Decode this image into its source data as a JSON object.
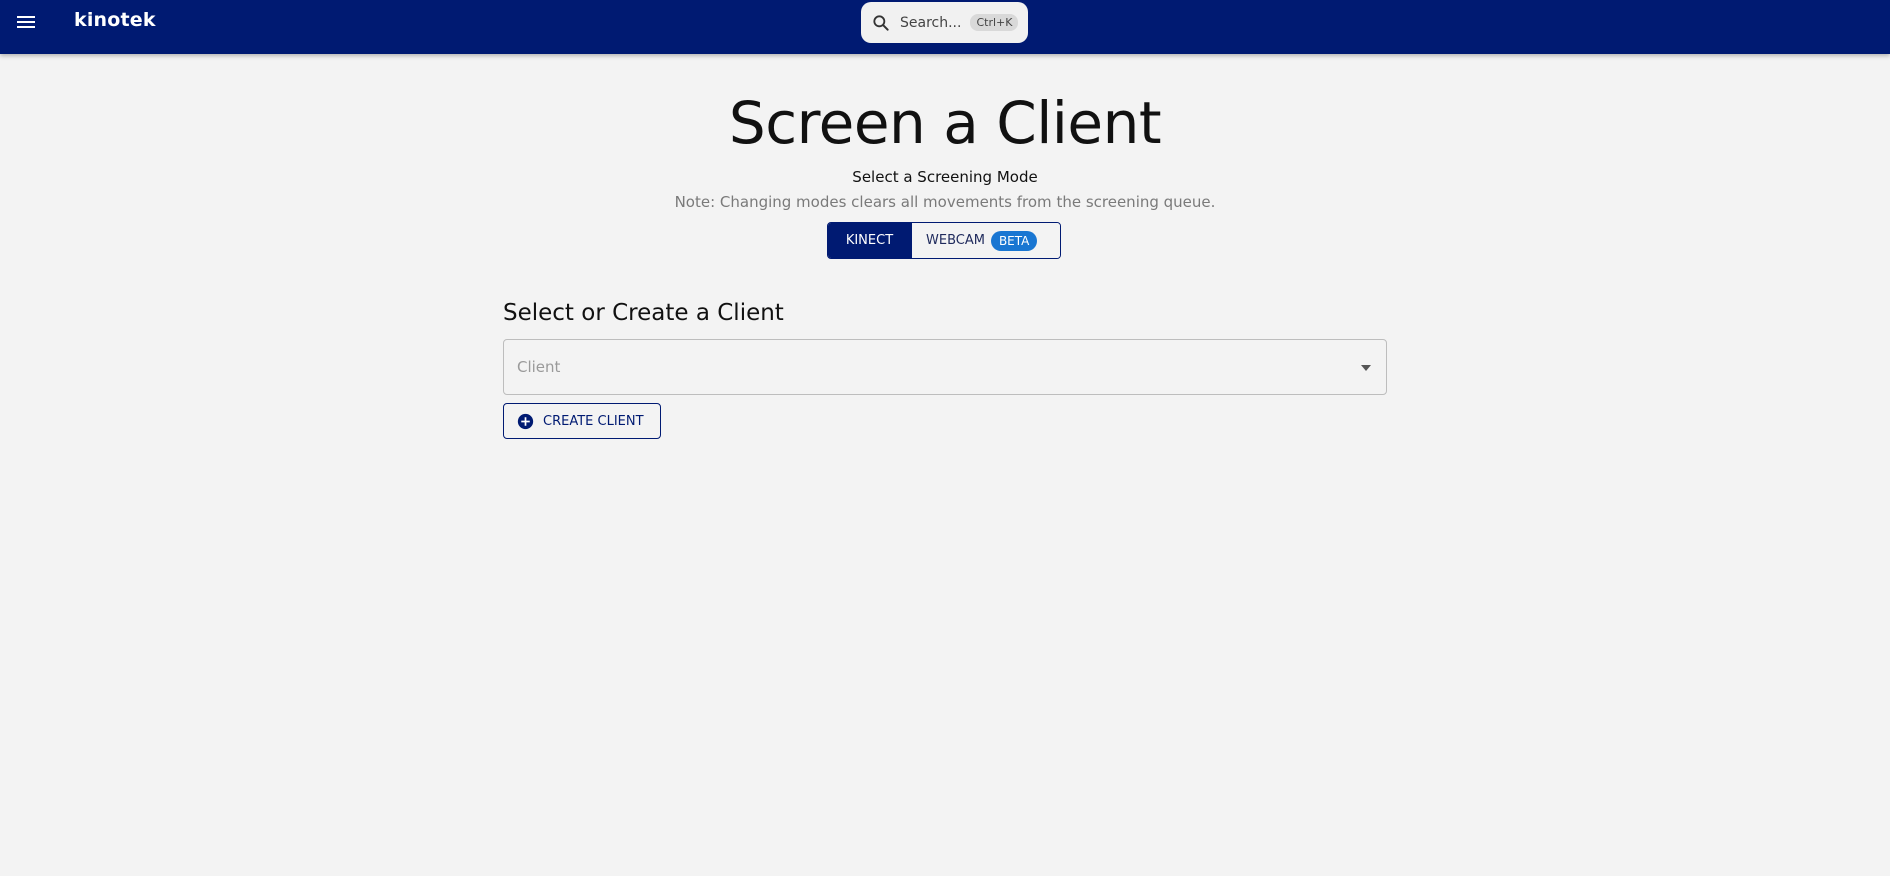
{
  "appbar": {
    "brand": "kinotek",
    "search": {
      "placeholder": "Search...",
      "shortcut": "Ctrl+K"
    },
    "menu_icon": "hamburger-menu-icon",
    "search_icon": "search-icon"
  },
  "page": {
    "title": "Screen a Client",
    "subtitle": "Select a Screening Mode",
    "note": "Note: Changing modes clears all movements from the screening queue."
  },
  "mode_toggle": {
    "selected": "KINECT",
    "options": [
      {
        "label": "KINECT",
        "active": true
      },
      {
        "label": "WEBCAM",
        "badge": "BETA",
        "active": false
      }
    ]
  },
  "client_section": {
    "title": "Select or Create a Client",
    "select": {
      "placeholder": "Client",
      "value": ""
    },
    "create_button": {
      "label": "CREATE CLIENT",
      "icon": "add-circle-icon"
    }
  },
  "colors": {
    "appbar": "#001a72",
    "background": "#f3f3f3",
    "beta_badge": "#1976d2"
  }
}
